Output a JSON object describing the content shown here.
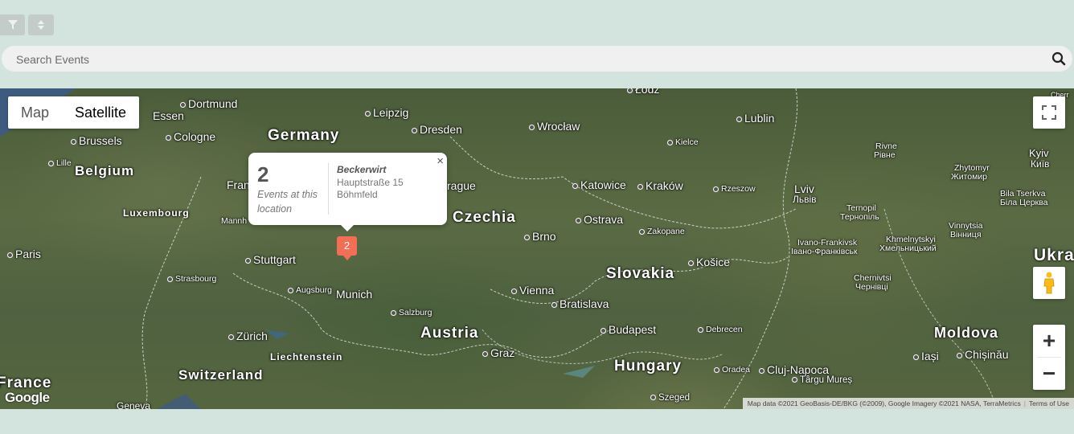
{
  "toolbar": {
    "filter_icon": "filter-icon",
    "sort_icon": "sort-icon"
  },
  "search": {
    "placeholder": "Search Events",
    "icon": "search-icon"
  },
  "map": {
    "type_buttons": [
      "Map",
      "Satellite"
    ],
    "active_type": "Satellite",
    "popup": {
      "count": "2",
      "count_label": "Events at this location",
      "venue": "Beckerwirt",
      "address_line1": "Hauptstraße 15",
      "address_line2": "Böhmfeld",
      "close": "×"
    },
    "marker_count": "2",
    "zoom_in": "+",
    "zoom_out": "−",
    "attribution": "Map data ©2021 GeoBasis-DE/BKG (©2009), Google Imagery ©2021 NASA, TerraMetrics",
    "terms": "Terms of Use",
    "logo": "Google",
    "labels": {
      "germany": "Germany",
      "czechia": "Czechia",
      "slovakia": "Slovakia",
      "austria": "Austria",
      "hungary": "Hungary",
      "switzerland": "Switzerland",
      "belgium": "Belgium",
      "luxembourg": "Luxembourg",
      "liechtenstein": "Liechtenstein",
      "moldova": "Moldova",
      "france": "France",
      "ukraine": "Ukra",
      "dortmund": "Dortmund",
      "essen": "Essen",
      "leipzig": "Leipzig",
      "dresden": "Dresden",
      "brussels": "Brussels",
      "cologne": "Cologne",
      "lille": "Lille",
      "frankfurt": "Fran",
      "mannheim": "Mannh",
      "prague": "rague",
      "wroclaw": "Wrocław",
      "lodz": "Łódź",
      "lublin": "Lublin",
      "kielce": "Kielce",
      "katowice": "Katowice",
      "krakow": "Kraków",
      "rzeszow": "Rzeszow",
      "lviv": "Lviv",
      "lviv_uk": "Львів",
      "ostrava": "Ostrava",
      "brno": "Brno",
      "zakopane": "Zakopane",
      "kosice": "Košice",
      "paris": "Paris",
      "stuttgart": "Stuttgart",
      "strasbourg": "Strasbourg",
      "augsburg": "Augsburg",
      "munich": "Munich",
      "salzburg": "Salzburg",
      "vienna": "Vienna",
      "bratislava": "Bratislava",
      "zurich": "Zürich",
      "graz": "Graz",
      "budapest": "Budapest",
      "debrecen": "Debrecen",
      "oradea": "Oradea",
      "cluj": "Cluj-Napoca",
      "targu": "Târgu Mureș",
      "szeged": "Szeged",
      "iasi": "Iași",
      "chisinau": "Chișinău",
      "geneva": "Geneva",
      "rivne": "Rivne",
      "rivne_uk": "Рівне",
      "zhytomyr": "Zhytomyr",
      "zhytomyr_uk": "Житомир",
      "kyiv": "Kyiv",
      "kyiv_uk": "Київ",
      "bila": "Bila Tserkva",
      "bila_uk": "Біла Церква",
      "ternopil": "Ternopil",
      "ternopil_uk": "Тернопіль",
      "vinnytsia": "Vinnytsia",
      "vinnytsia_uk": "Вінниця",
      "ivano": "Ivano-Frankivsk",
      "ivano_uk": "Івано-Франківськ",
      "khmel": "Khmelnytskyi",
      "khmel_uk": "Хмельницький",
      "chernivtsi": "Chernivtsi",
      "chernivtsi_uk": "Чернівці",
      "cherr": "Cherr"
    }
  }
}
